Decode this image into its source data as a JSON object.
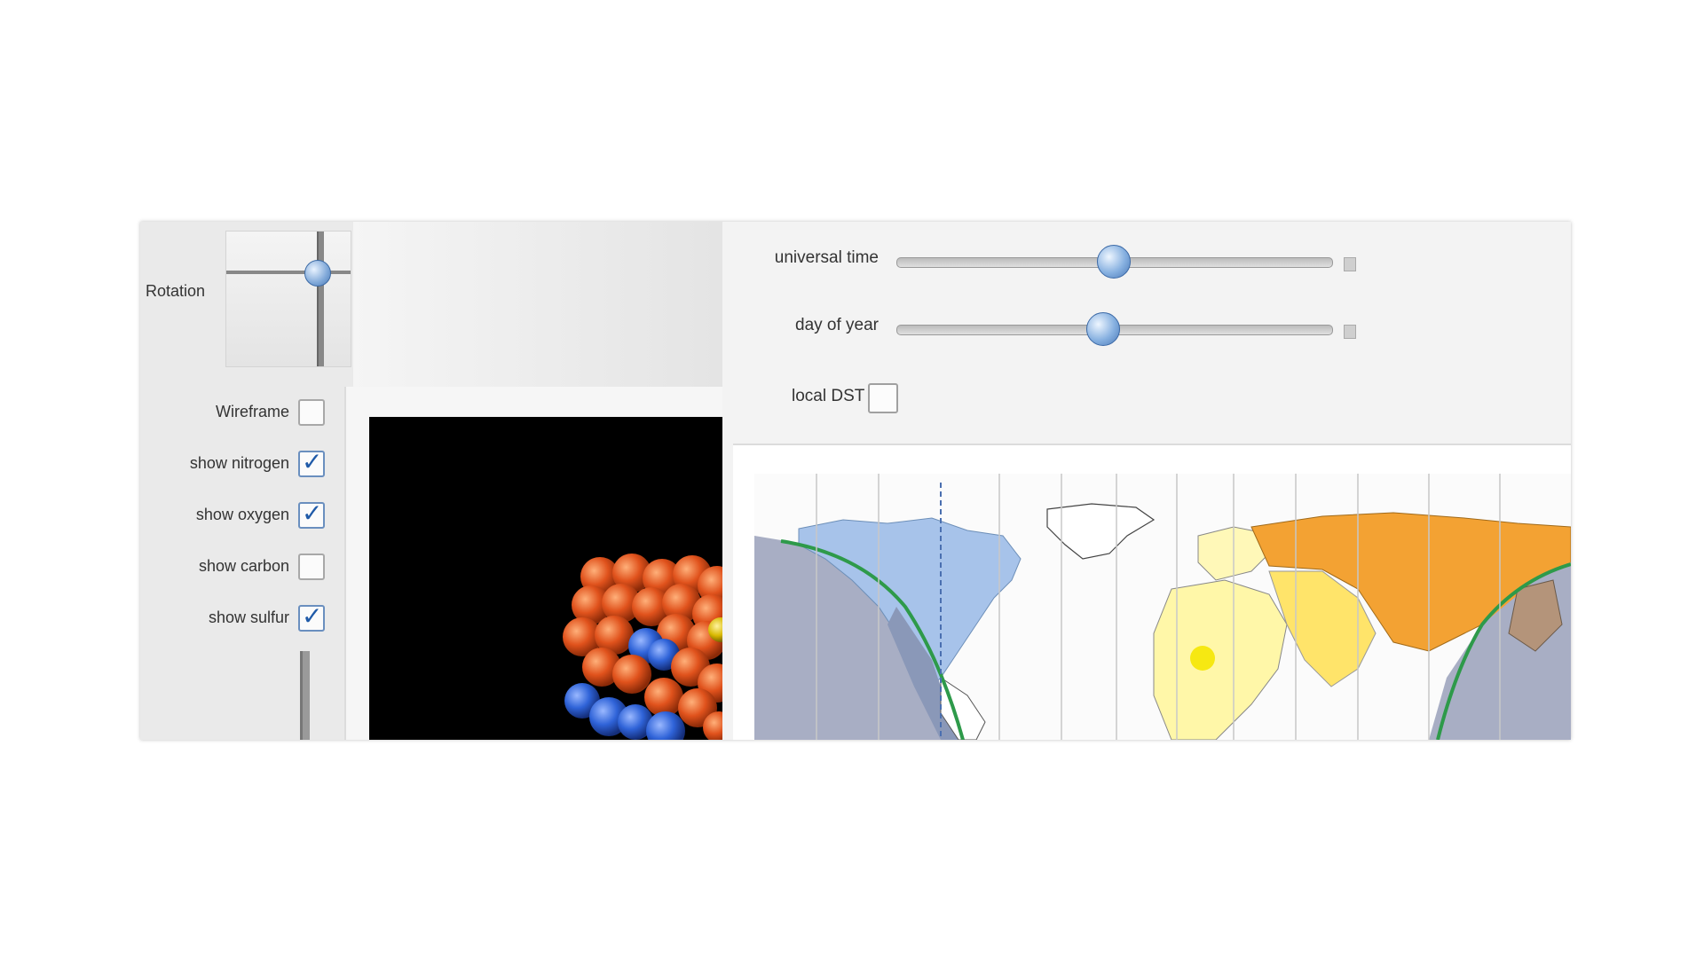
{
  "left_panel": {
    "rotation_label": "Rotation",
    "options": [
      {
        "label": "Wireframe",
        "checked": false
      },
      {
        "label": "show nitrogen",
        "checked": true
      },
      {
        "label": "show oxygen",
        "checked": true
      },
      {
        "label": "show carbon",
        "checked": false
      },
      {
        "label": "show sulfur",
        "checked": true
      }
    ]
  },
  "right_panel": {
    "sliders": [
      {
        "label": "universal time",
        "value": 0.5
      },
      {
        "label": "day of year",
        "value": 0.48
      }
    ],
    "dst_label": "local DST",
    "dst_checked": false
  },
  "colors": {
    "accent": "#4a78b6",
    "molecule_oxygen": "#e0521c",
    "molecule_nitrogen": "#2f63d8",
    "night_shade": "#a8aec4",
    "terminator": "#2e9a4a"
  }
}
